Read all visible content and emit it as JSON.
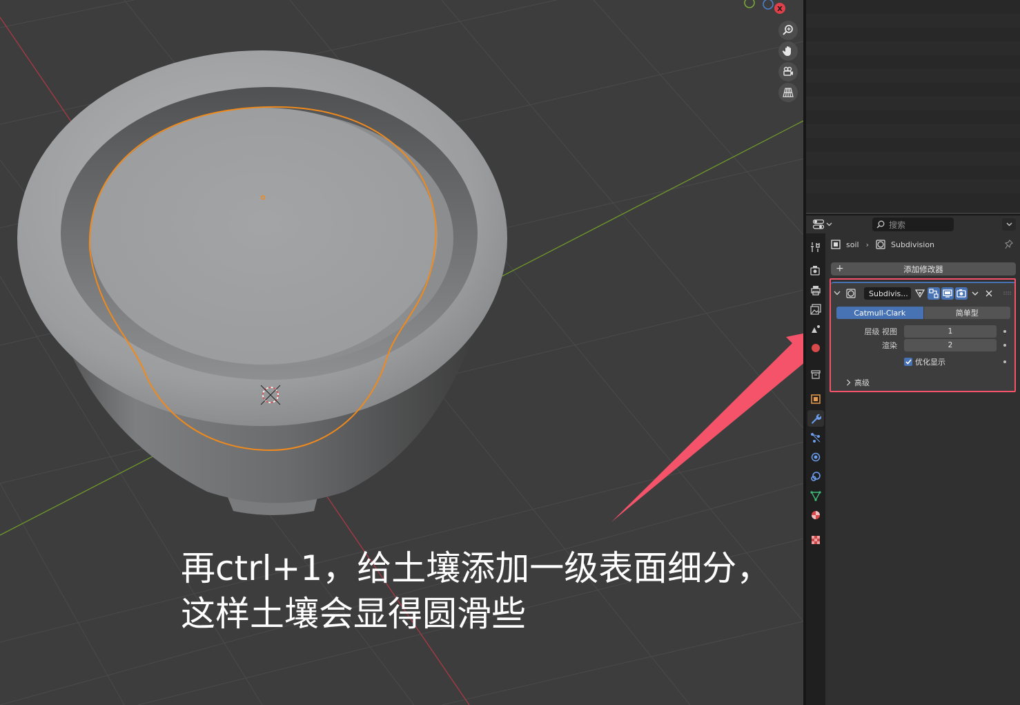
{
  "viewport": {
    "caption_line1": "再ctrl+1，给土壤添加一级表面细分，",
    "caption_line2": "这样土壤会显得圆滑些",
    "gizmo_x_label": "X",
    "nav_icons": [
      "zoom-icon",
      "hand-pan-icon",
      "camera-icon",
      "perspective-grid-icon"
    ]
  },
  "properties": {
    "search_placeholder": "搜索",
    "breadcrumb": {
      "object": "soil",
      "modifier": "Subdivision"
    },
    "add_modifier_label": "添加修改器",
    "modifier": {
      "name": "Subdivis...",
      "mode_catmull": "Catmull-Clark",
      "mode_simple": "简单型",
      "levels_viewport_label": "层级 视图",
      "levels_viewport_value": "1",
      "render_label": "渲染",
      "render_value": "2",
      "optimal_display_label": "优化显示",
      "optimal_display_checked": true,
      "advanced_label": "高级"
    },
    "tabs": [
      "tool",
      "render",
      "output",
      "view-layer",
      "scene",
      "world",
      "collection",
      "object",
      "modifier",
      "particles",
      "physics",
      "constraints",
      "data",
      "material",
      "texture"
    ],
    "active_tab": "modifier"
  },
  "colors": {
    "accent_blue": "#4772b3",
    "selection_orange": "#f08a1c",
    "annotation_red": "#f4536a",
    "x_axis_red": "#a83a45",
    "y_axis_green": "#6f9a2a"
  }
}
